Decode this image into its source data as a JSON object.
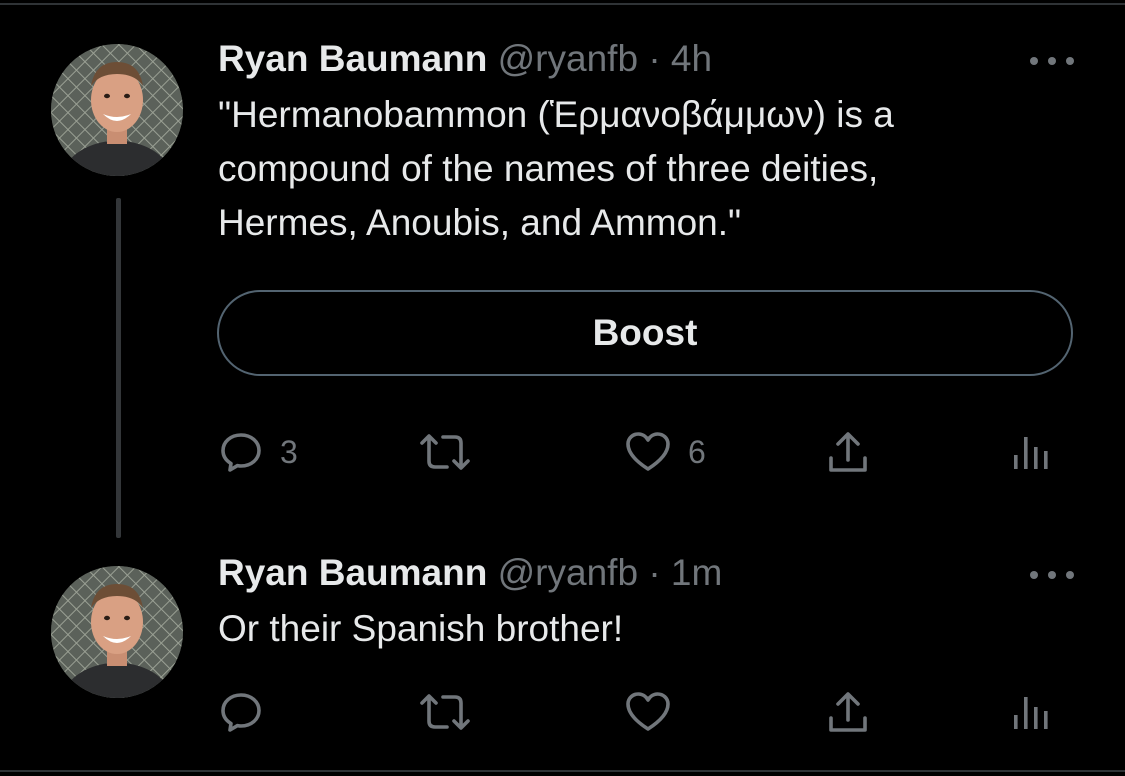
{
  "tweets": [
    {
      "display_name": "Ryan Baumann",
      "handle": "@ryanfb",
      "separator": "·",
      "time": "4h",
      "text": "\"Hermanobammon (Ἑρμανοβάμμων) is a\ncompound of the names of three deities,\nHermes, Anoubis, and Ammon.\"",
      "button_label": "Boost",
      "reply_count": "3",
      "retweet_count": "",
      "like_count": "6"
    },
    {
      "display_name": "Ryan Baumann",
      "handle": "@ryanfb",
      "separator": "·",
      "time": "1m",
      "text": "Or their Spanish brother!",
      "reply_count": "",
      "retweet_count": "",
      "like_count": ""
    }
  ],
  "icons": {
    "more": "more-horizontal-icon",
    "reply": "reply-icon",
    "retweet": "retweet-icon",
    "like": "heart-icon",
    "share": "share-icon",
    "views": "views-icon"
  },
  "colors": {
    "background": "#000000",
    "text_primary": "#e7e9ea",
    "text_secondary": "#71767b",
    "button_border": "#536471",
    "thread_line": "#333639"
  }
}
